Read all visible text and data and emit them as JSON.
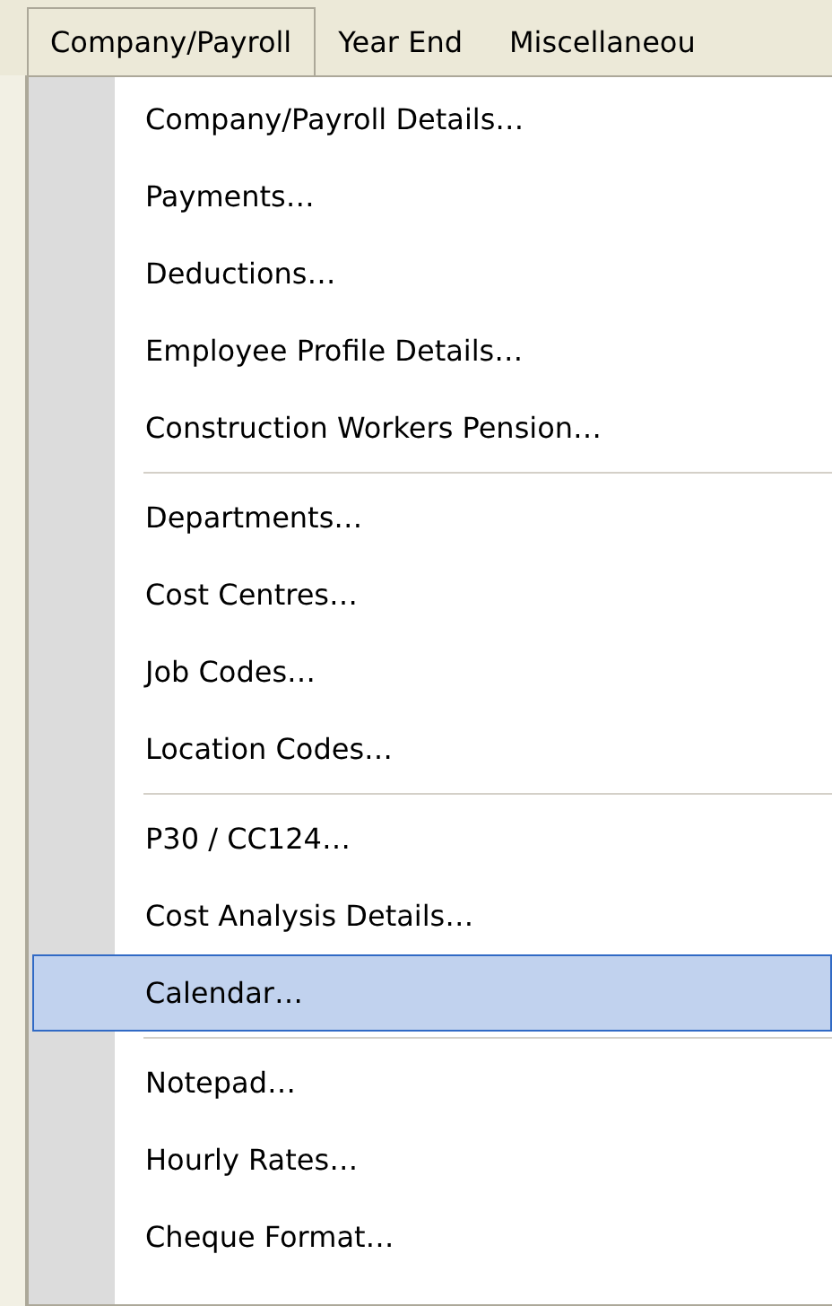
{
  "menu_bar": {
    "menus": [
      {
        "label": "Company/Payroll",
        "selected": true
      },
      {
        "label": "Year End",
        "selected": false
      },
      {
        "label": "Miscellaneou",
        "selected": false
      }
    ]
  },
  "dropdown": {
    "items": [
      {
        "kind": "item",
        "label": "Company/Payroll Details…",
        "selected": false
      },
      {
        "kind": "item",
        "label": "Payments…",
        "selected": false
      },
      {
        "kind": "item",
        "label": "Deductions…",
        "selected": false
      },
      {
        "kind": "item",
        "label": "Employee Profile Details…",
        "selected": false
      },
      {
        "kind": "item",
        "label": "Construction Workers Pension…",
        "selected": false
      },
      {
        "kind": "separator"
      },
      {
        "kind": "item",
        "label": "Departments…",
        "selected": false
      },
      {
        "kind": "item",
        "label": "Cost Centres…",
        "selected": false
      },
      {
        "kind": "item",
        "label": "Job Codes…",
        "selected": false
      },
      {
        "kind": "item",
        "label": "Location Codes…",
        "selected": false
      },
      {
        "kind": "separator"
      },
      {
        "kind": "item",
        "label": "P30 / CC124…",
        "selected": false
      },
      {
        "kind": "item",
        "label": "Cost Analysis Details…",
        "selected": false
      },
      {
        "kind": "item",
        "label": "Calendar…",
        "selected": true
      },
      {
        "kind": "separator"
      },
      {
        "kind": "item",
        "label": "Notepad…",
        "selected": false
      },
      {
        "kind": "item",
        "label": "Hourly Rates…",
        "selected": false
      },
      {
        "kind": "item",
        "label": "Cheque Format…",
        "selected": false
      }
    ]
  }
}
